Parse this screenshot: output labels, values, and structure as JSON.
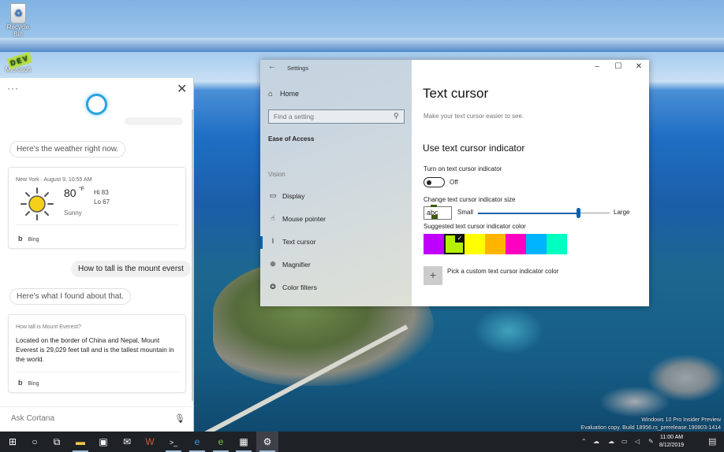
{
  "desktop": {
    "icons": [
      {
        "label": "Recycle Bin"
      },
      {
        "label": "Microsoft",
        "badge": "DEV"
      }
    ],
    "watermark": {
      "line1": "Windows 10 Pro Insider Preview",
      "line2": "Evaluation copy. Build 18956.rs_prerelease.190803-1414"
    }
  },
  "cortana": {
    "more_label": "···",
    "close_label": "✕",
    "messages": [
      {
        "from": "cortana",
        "text": "Here's the weather right now."
      },
      {
        "from": "user",
        "text": "How to tall is the mount everst"
      },
      {
        "from": "cortana",
        "text": "Here's what I found about that."
      }
    ],
    "weather": {
      "header": "New York  ·  August 9, 10:55 AM",
      "temp": "80",
      "unit": "°F",
      "hi": "Hi 83",
      "lo": "Lo 67",
      "condition": "Sunny",
      "source": "Bing"
    },
    "answer": {
      "question": "How tall is Mount Everest?",
      "body": "Located on the border of China and Nepal, Mount Everest is 29,029 feet tall and is the tallest mountain in the world.",
      "source": "Bing"
    },
    "ask_placeholder": "Ask Cortana"
  },
  "settings": {
    "window_title": "Settings",
    "nav": {
      "home": "Home",
      "search_placeholder": "Find a setting",
      "section": "Ease of Access",
      "group": "Vision",
      "items": [
        {
          "label": "Display",
          "icon": "display-icon",
          "active": false
        },
        {
          "label": "Mouse pointer",
          "icon": "mouse-pointer-icon",
          "active": false
        },
        {
          "label": "Text cursor",
          "icon": "text-cursor-icon",
          "active": true
        },
        {
          "label": "Magnifier",
          "icon": "magnifier-icon",
          "active": false
        },
        {
          "label": "Color filters",
          "icon": "color-filters-icon",
          "active": false
        }
      ]
    },
    "page": {
      "title": "Text cursor",
      "subtitle": "Make your text cursor easier to see.",
      "heading": "Use text cursor indicator",
      "toggle_label": "Turn on text cursor indicator",
      "toggle_state": "Off",
      "toggle_on": false,
      "size_label": "Change text cursor indicator size",
      "preview_text": "abc",
      "size_min_label": "Small",
      "size_max_label": "Large",
      "size_value_fraction": 0.76,
      "color_label": "Suggested text cursor indicator color",
      "colors": [
        "#c000ff",
        "#b4f000",
        "#ffff00",
        "#ffb400",
        "#ff00c0",
        "#00b4ff",
        "#00ffc0"
      ],
      "selected_color_index": 1,
      "custom_color_label": "Pick a custom text cursor indicator color"
    }
  },
  "taskbar": {
    "items": [
      {
        "name": "start",
        "glyph": "⊞"
      },
      {
        "name": "search",
        "glyph": "○"
      },
      {
        "name": "task-view",
        "glyph": "⧉"
      },
      {
        "name": "file-explorer",
        "glyph": "▬"
      },
      {
        "name": "store",
        "glyph": "▣"
      },
      {
        "name": "mail",
        "glyph": "✉"
      },
      {
        "name": "app-w",
        "glyph": "W"
      },
      {
        "name": "terminal",
        "glyph": ">_"
      },
      {
        "name": "edge",
        "glyph": "e"
      },
      {
        "name": "edge-dev",
        "glyph": "e"
      },
      {
        "name": "app-tiles",
        "glyph": "▦"
      },
      {
        "name": "settings",
        "glyph": "⚙"
      }
    ],
    "clock": {
      "time": "11:00 AM",
      "date": "8/12/2019"
    }
  }
}
